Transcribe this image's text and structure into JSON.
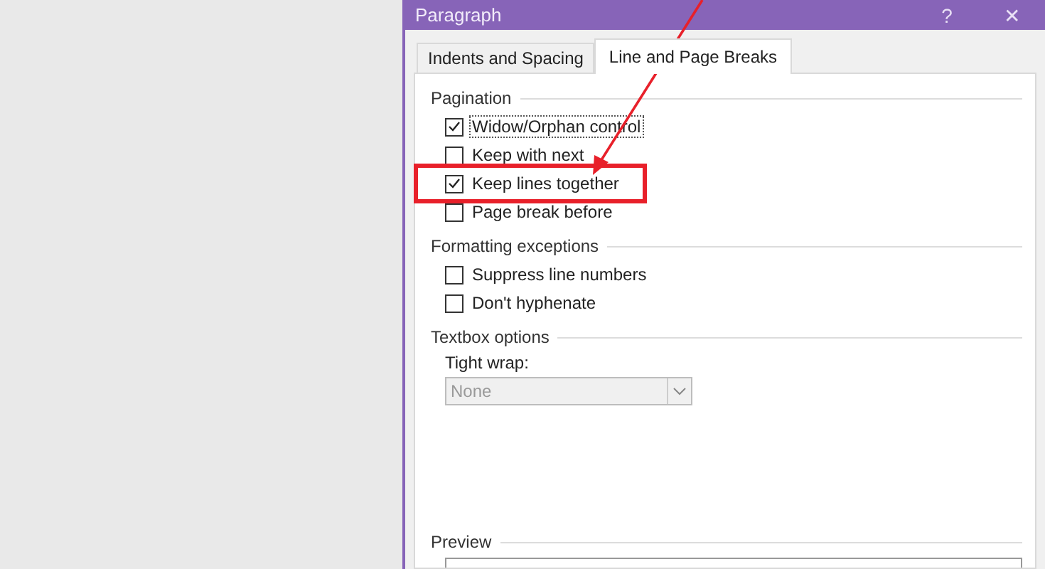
{
  "window": {
    "title": "Paragraph",
    "help": "?",
    "close": "✕"
  },
  "tabs": [
    {
      "label": "Indents and Spacing",
      "selected": false
    },
    {
      "label": "Line and Page Breaks",
      "selected": true
    }
  ],
  "sections": [
    {
      "title": "Pagination",
      "options": [
        {
          "label": "Widow/Orphan control",
          "checked": true,
          "focused": true,
          "highlighted": false
        },
        {
          "label": "Keep with next",
          "checked": false,
          "focused": false,
          "highlighted": false
        },
        {
          "label": "Keep lines together",
          "checked": true,
          "focused": false,
          "highlighted": true
        },
        {
          "label": "Page break before",
          "checked": false,
          "focused": false,
          "highlighted": false
        }
      ]
    },
    {
      "title": "Formatting exceptions",
      "options": [
        {
          "label": "Suppress line numbers",
          "checked": false,
          "focused": false,
          "highlighted": false
        },
        {
          "label": "Don't hyphenate",
          "checked": false,
          "focused": false,
          "highlighted": false
        }
      ]
    },
    {
      "title": "Textbox options",
      "field": {
        "label": "Tight wrap:",
        "value": "None",
        "disabled": true
      }
    }
  ],
  "preview": {
    "title": "Preview"
  }
}
